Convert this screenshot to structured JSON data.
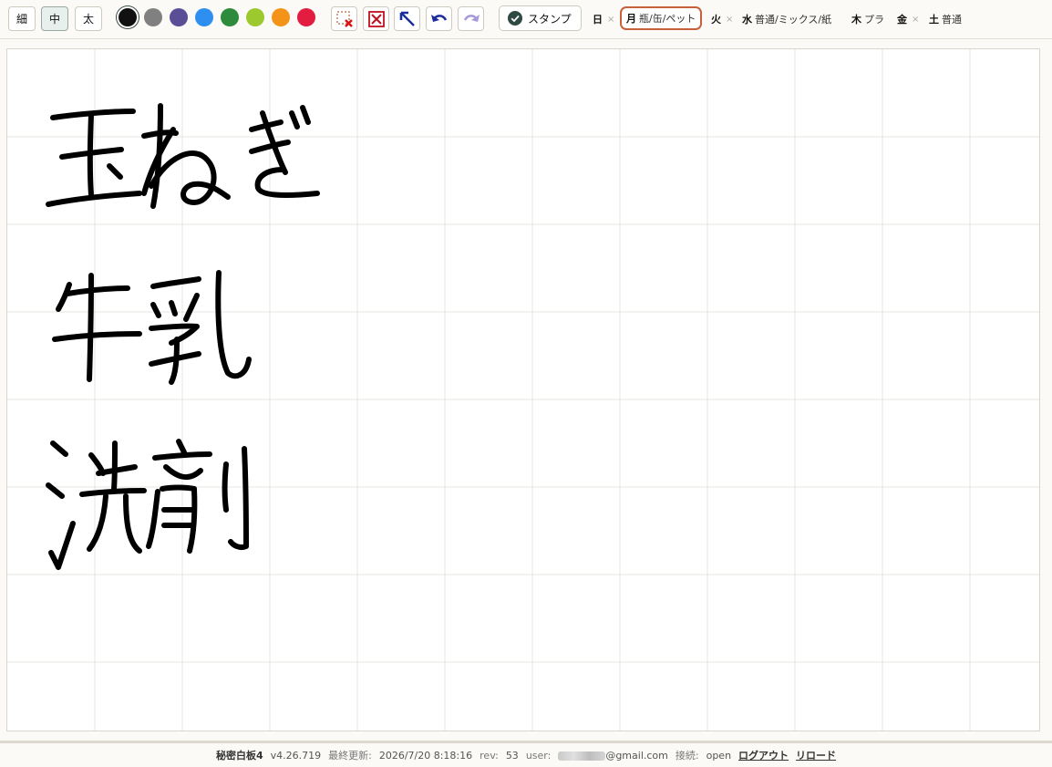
{
  "toolbar": {
    "widths": [
      {
        "label": "細",
        "active": false
      },
      {
        "label": "中",
        "active": true
      },
      {
        "label": "太",
        "active": false
      }
    ],
    "colors": [
      "#111111",
      "#808080",
      "#5a4e96",
      "#2f8ff0",
      "#2e8b3c",
      "#9cc92e",
      "#f39318",
      "#e21d40"
    ],
    "selected_color": "#111111",
    "tools": [
      "clear-selection-icon",
      "clear-all-icon",
      "arrow-up-left-icon",
      "undo-icon",
      "redo-icon"
    ],
    "stamp_label": "スタンプ",
    "schedule": [
      {
        "day": "日",
        "value": "",
        "removable": true,
        "today": false
      },
      {
        "day": "月",
        "value": "瓶/缶/ペット",
        "removable": false,
        "today": true
      },
      {
        "day": "火",
        "value": "",
        "removable": true,
        "today": false
      },
      {
        "day": "水",
        "value": "普通/ミックス/紙",
        "removable": false,
        "today": false
      },
      {
        "day": "木",
        "value": "プラ",
        "removable": false,
        "today": false
      },
      {
        "day": "金",
        "value": "",
        "removable": true,
        "today": false
      },
      {
        "day": "土",
        "value": "普通",
        "removable": false,
        "today": false
      }
    ]
  },
  "board": {
    "handwritten_items": [
      "玉ねぎ",
      "牛乳",
      "洗剤"
    ]
  },
  "footer": {
    "app_name": "秘密白板4",
    "version": "v4.26.719",
    "updated_label": "最終更新:",
    "updated_value": "2026/7/20 8:18:16",
    "rev_label": "rev:",
    "rev_value": "53",
    "user_label": "user:",
    "user_domain": "@gmail.com",
    "conn_label": "接続:",
    "conn_value": "open",
    "logout": "ログアウト",
    "reload": "リロード"
  }
}
